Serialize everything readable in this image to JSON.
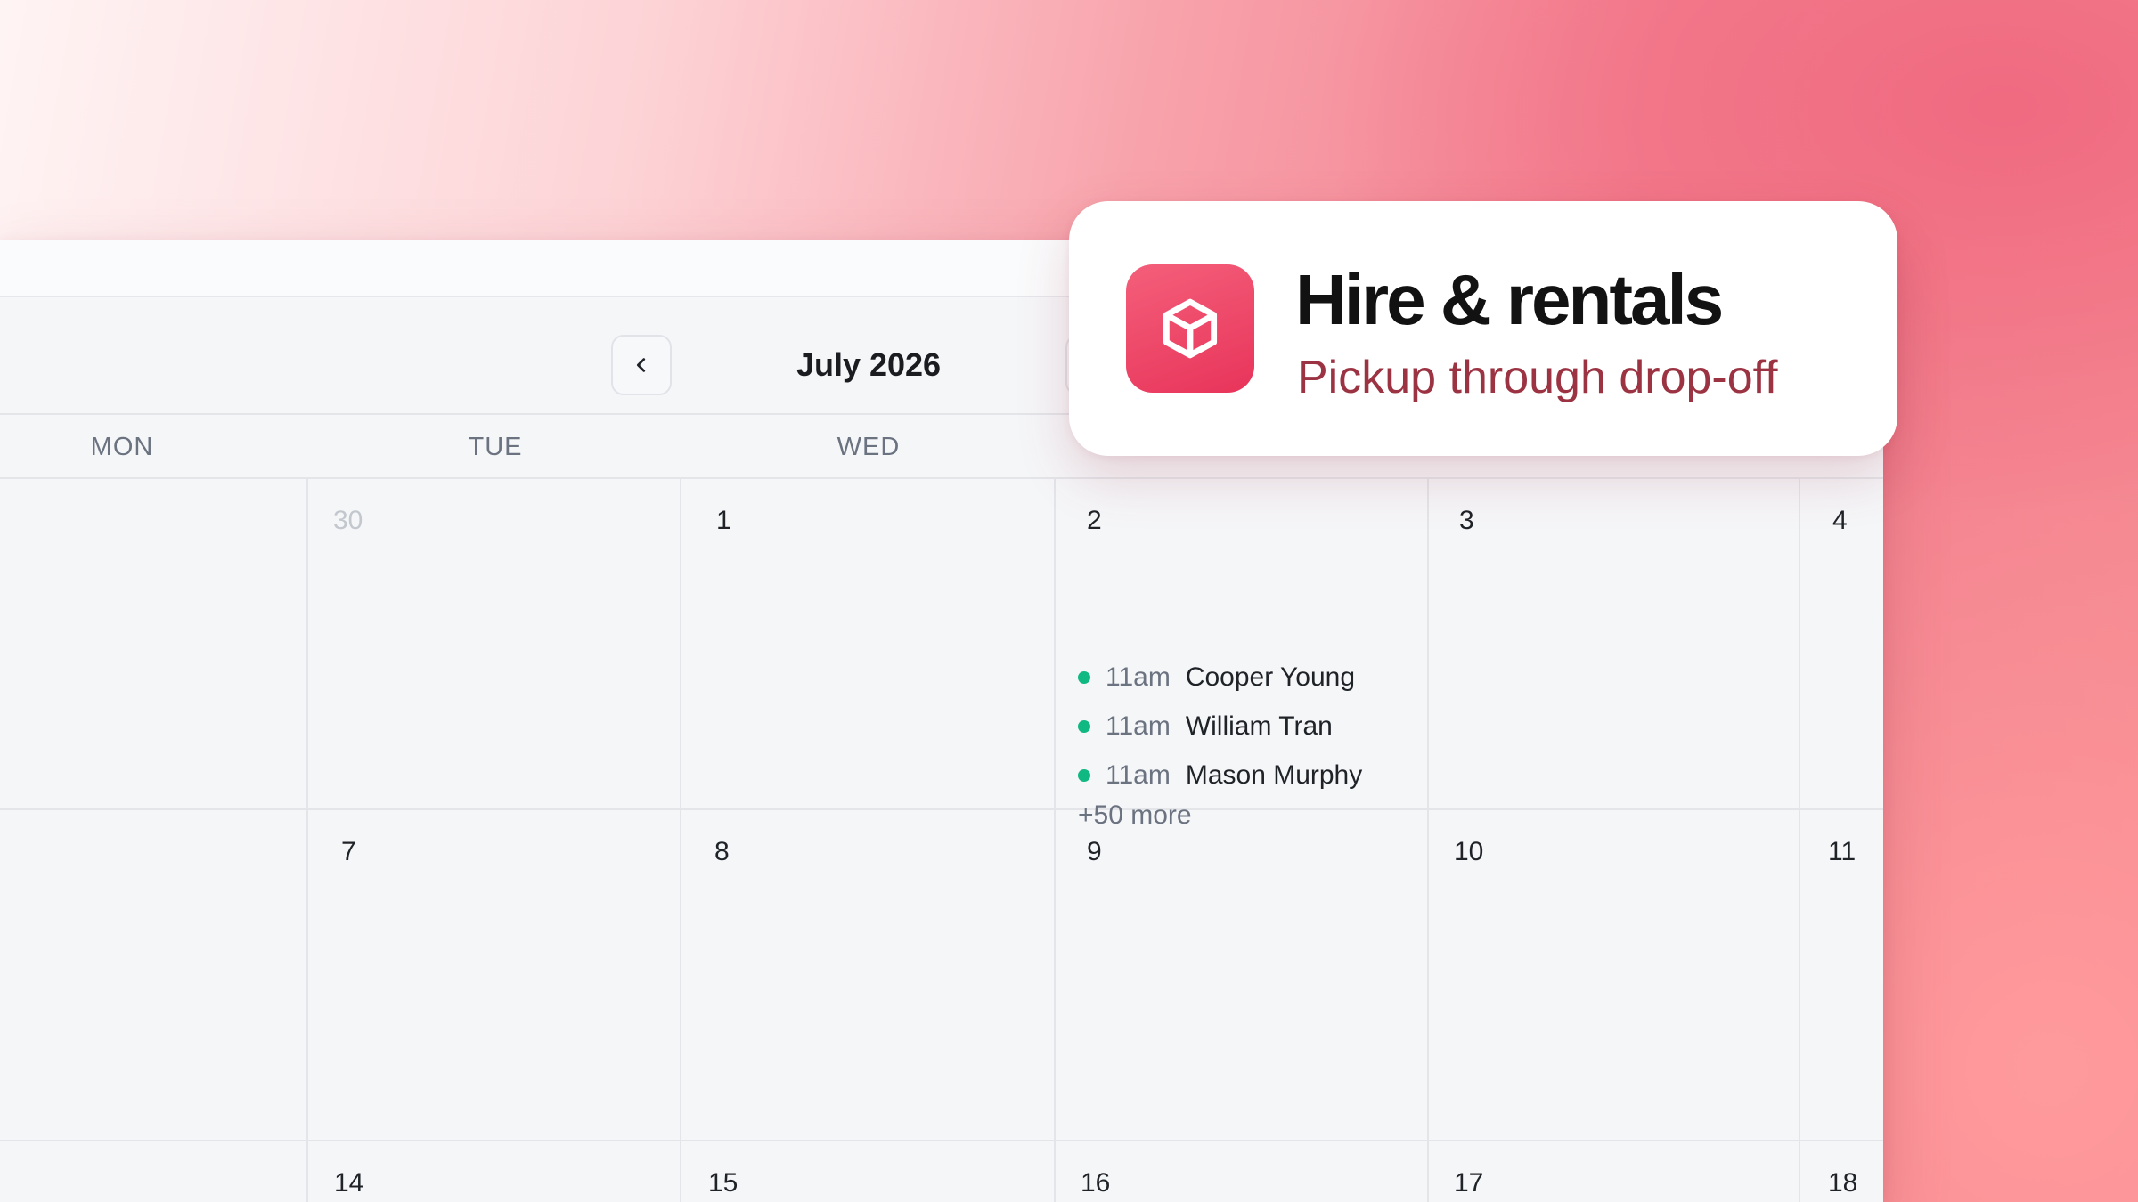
{
  "calendar": {
    "month_title": "July 2026",
    "weekdays": [
      "MON",
      "TUE",
      "WED"
    ],
    "rows": [
      [
        "",
        "30",
        "1",
        "2",
        "3",
        "4"
      ],
      [
        "",
        "7",
        "8",
        "9",
        "10",
        "11"
      ],
      [
        "",
        "14",
        "15",
        "16",
        "17",
        "18"
      ]
    ],
    "events": [
      {
        "time": "11am",
        "name": "Cooper Young",
        "color": "#10b981"
      },
      {
        "time": "11am",
        "name": "William Tran",
        "color": "#10b981"
      },
      {
        "time": "11am",
        "name": "Mason Murphy",
        "color": "#10b981"
      }
    ],
    "more_label": "+50 more"
  },
  "badge": {
    "title": "Hire & rentals",
    "subtitle": "Pickup through drop-off",
    "icon": "box-icon",
    "icon_color": "#e8345a"
  },
  "icons": {
    "prev": "chevron-left-icon",
    "next": "chevron-right-icon"
  }
}
